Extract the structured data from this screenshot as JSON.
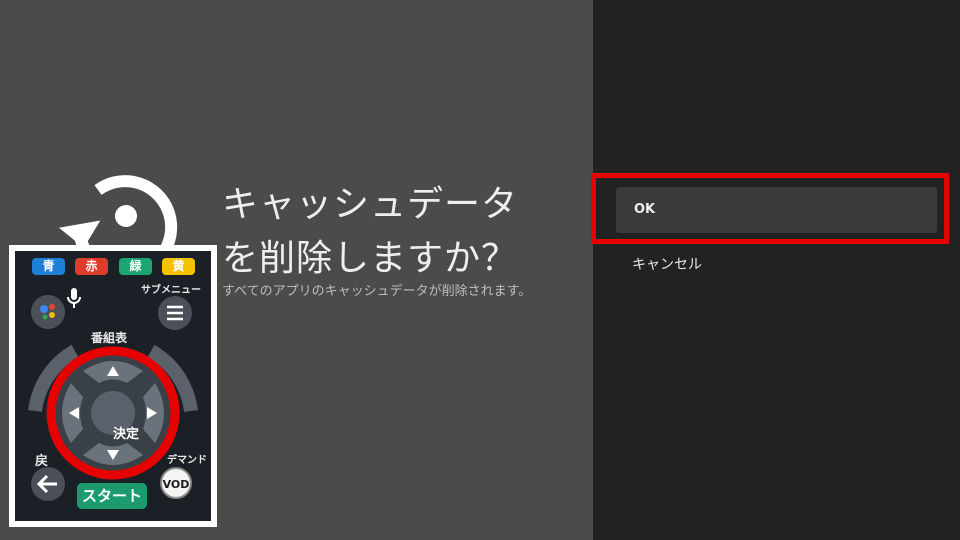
{
  "dialog": {
    "title": "キャッシュデータを削除しますか？",
    "description": "すべてのアプリのキャッシュデータが削除されます。",
    "icon": "reset-icon"
  },
  "actions": {
    "ok_label": "OK",
    "cancel_label": "キャンセル",
    "selected": "OK"
  },
  "highlight_color": "#e60000",
  "remote": {
    "color_buttons": [
      {
        "label": "青",
        "color": "#1e7fd6"
      },
      {
        "label": "赤",
        "color": "#e03c2c"
      },
      {
        "label": "緑",
        "color": "#1aa571"
      },
      {
        "label": "黄",
        "color": "#f3c300"
      }
    ],
    "submenu_label": "サブメニュー",
    "guide_label": "番組表",
    "enter_label": "決定",
    "back_label": "戻",
    "ondemand_label": "デマンド",
    "start_label": "スタート",
    "vod_label": "VOD"
  }
}
